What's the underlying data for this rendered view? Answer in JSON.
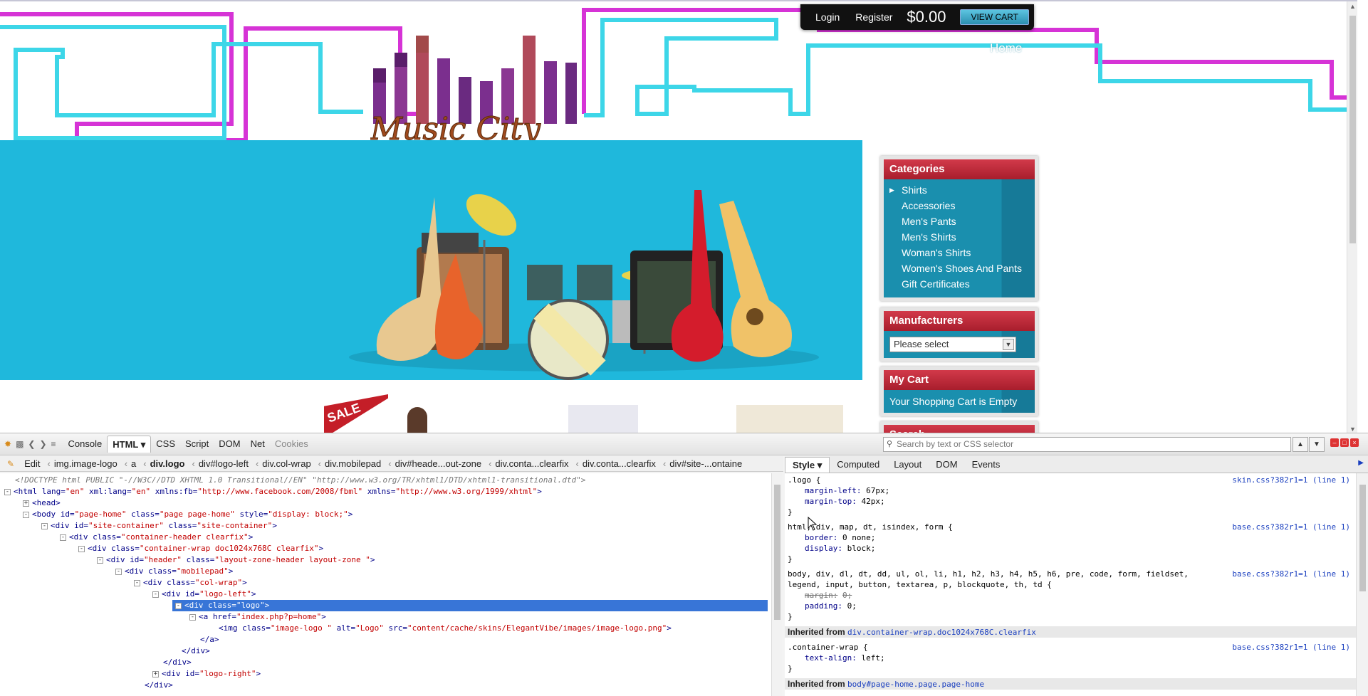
{
  "site": {
    "top_bar": {
      "login": "Login",
      "register": "Register",
      "cart_total": "$0.00",
      "view_cart": "VIEW CART"
    },
    "nav": {
      "home": "Home"
    },
    "logo_text": "Music City",
    "sale_badge": "SALE",
    "categories": {
      "title": "Categories",
      "items": [
        "Shirts",
        "Accessories",
        "Men's Pants",
        "Men's Shirts",
        "Woman's Shirts",
        "Women's Shoes And Pants",
        "Gift Certificates"
      ]
    },
    "manufacturers": {
      "title": "Manufacturers",
      "select_value": "Please select"
    },
    "my_cart": {
      "title": "My Cart",
      "text": "Your Shopping Cart is Empty"
    },
    "search": {
      "title": "Search"
    },
    "colors": {
      "banner": "#1fb8dc",
      "box_header": "#c12737",
      "box_body": "#1a8faf",
      "neon_magenta": "#d633d6",
      "neon_cyan": "#3dd6e8"
    }
  },
  "devtools": {
    "tabs": [
      "Console",
      "HTML",
      "CSS",
      "Script",
      "DOM",
      "Net",
      "Cookies"
    ],
    "active_tab": "HTML",
    "search_placeholder": "Search by text or CSS selector",
    "edit_label": "Edit",
    "breadcrumbs": [
      "img.image-logo",
      "a",
      "div.logo",
      "div#logo-left",
      "div.col-wrap",
      "div.mobilepad",
      "div#heade...out-zone",
      "div.conta...clearfix",
      "div.conta...clearfix",
      "div#site-...ontaine"
    ],
    "side_tabs": [
      "Style",
      "Computed",
      "Layout",
      "DOM",
      "Events"
    ],
    "html_lines": [
      {
        "indent": 0,
        "toggle": "",
        "cls": "dt",
        "text": "<!DOCTYPE html PUBLIC \"-//W3C//DTD XHTML 1.0 Transitional//EN\" \"http://www.w3.org/TR/xhtml1/DTD/xhtml1-transitional.dtd\">"
      },
      {
        "indent": 0,
        "toggle": "-",
        "text": "<html lang=\"en\" xml:lang=\"en\" xmlns:fb=\"http://www.facebook.com/2008/fbml\" xmlns=\"http://www.w3.org/1999/xhtml\">"
      },
      {
        "indent": 1,
        "toggle": "+",
        "text": "<head>"
      },
      {
        "indent": 1,
        "toggle": "-",
        "text": "<body id=\"page-home\" class=\"page page-home\" style=\"display: block;\">"
      },
      {
        "indent": 2,
        "toggle": "-",
        "text": "<div id=\"site-container\" class=\"site-container\">"
      },
      {
        "indent": 3,
        "toggle": "-",
        "text": "<div class=\"container-header clearfix\">"
      },
      {
        "indent": 4,
        "toggle": "-",
        "text": "<div class=\"container-wrap doc1024x768C clearfix\">"
      },
      {
        "indent": 5,
        "toggle": "-",
        "text": "<div id=\"header\" class=\"layout-zone-header layout-zone \">"
      },
      {
        "indent": 6,
        "toggle": "-",
        "text": "<div class=\"mobilepad\">"
      },
      {
        "indent": 7,
        "toggle": "-",
        "text": "<div class=\"col-wrap\">"
      },
      {
        "indent": 8,
        "toggle": "-",
        "text": "<div id=\"logo-left\">"
      },
      {
        "indent": 9,
        "toggle": "-",
        "text": "<div class=\"logo\">",
        "selected": true
      },
      {
        "indent": 10,
        "toggle": "-",
        "text": "<a href=\"index.php?p=home\">"
      },
      {
        "indent": 11,
        "toggle": "",
        "text": "<img class=\"image-logo \" alt=\"Logo\" src=\"content/cache/skins/ElegantVibe/images/image-logo.png\">"
      },
      {
        "indent": 10,
        "toggle": "",
        "text": "</a>"
      },
      {
        "indent": 9,
        "toggle": "",
        "text": "</div>"
      },
      {
        "indent": 8,
        "toggle": "",
        "text": "</div>"
      },
      {
        "indent": 8,
        "toggle": "+",
        "text": "<div id=\"logo-right\">"
      },
      {
        "indent": 7,
        "toggle": "",
        "text": "</div>"
      }
    ],
    "css_rules": [
      {
        "selector": ".logo {",
        "source": "skin.css?382r1=1 (line 1)",
        "props": [
          {
            "name": "margin-left",
            "value": "67px;"
          },
          {
            "name": "margin-top",
            "value": "42px;"
          }
        ]
      },
      {
        "selector": "html, div, map, dt, isindex, form {",
        "source": "base.css?382r1=1 (line 1)",
        "props": [
          {
            "name": "border",
            "value": "0 none;"
          },
          {
            "name": "display",
            "value": "block;"
          }
        ]
      },
      {
        "selector": "body, div, dl, dt, dd, ul, ol, li, h1, h2, h3, h4, h5, h6, pre, code, form, fieldset,",
        "selector2": "legend, input, button, textarea, p, blockquote, th, td {",
        "source": "base.css?382r1=1 (line 1)",
        "props": [
          {
            "name": "margin",
            "value": "0;",
            "struck": true
          },
          {
            "name": "padding",
            "value": "0;"
          }
        ]
      },
      {
        "inherited": "Inherited from ",
        "from": "div.container-wrap.doc1024x768C.clearfix"
      },
      {
        "selector": ".container-wrap {",
        "source": "base.css?382r1=1 (line 1)",
        "props": [
          {
            "name": "text-align",
            "value": "left;"
          }
        ]
      },
      {
        "inherited": "Inherited from ",
        "from": "body#page-home.page.page-home"
      }
    ]
  }
}
